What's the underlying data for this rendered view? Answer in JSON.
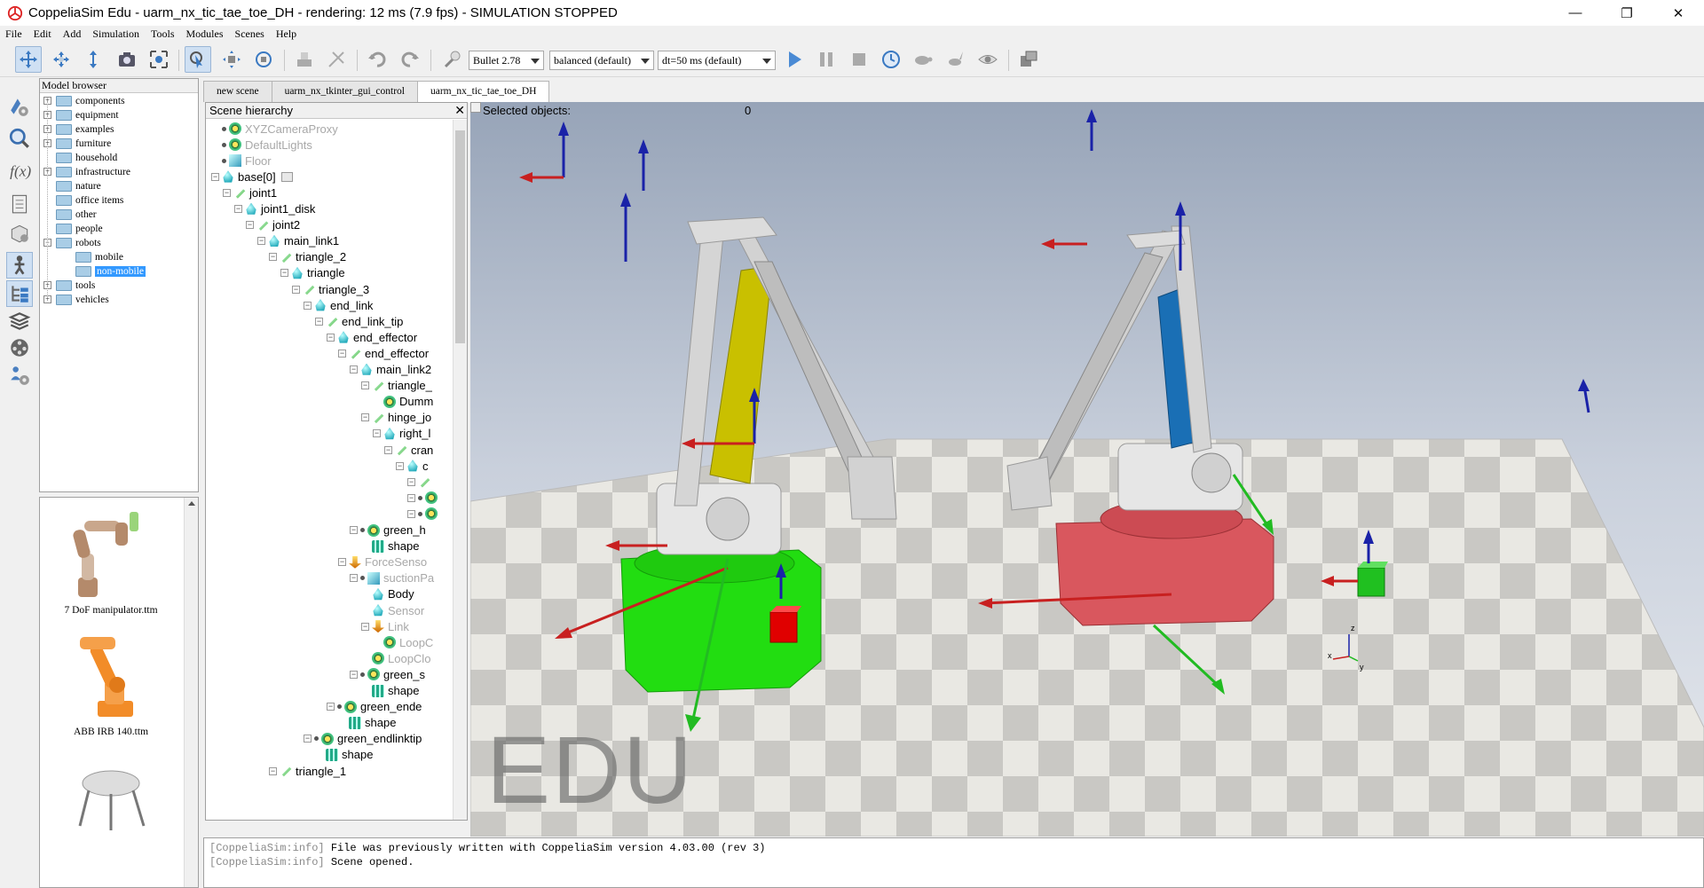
{
  "window": {
    "title": "CoppeliaSim Edu - uarm_nx_tic_tae_toe_DH - rendering: 12 ms (7.9 fps) - SIMULATION STOPPED",
    "minimize": "—",
    "maximize": "❐",
    "close": "✕"
  },
  "menu": [
    "File",
    "Edit",
    "Add",
    "Simulation",
    "Tools",
    "Modules",
    "Scenes",
    "Help"
  ],
  "toolbar": {
    "physics_engine": "Bullet 2.78",
    "accuracy": "balanced (default)",
    "timestep": "dt=50 ms (default)"
  },
  "model_browser": {
    "title": "Model browser",
    "items": [
      {
        "label": "components",
        "expandable": true,
        "level": 0
      },
      {
        "label": "equipment",
        "expandable": true,
        "level": 0
      },
      {
        "label": "examples",
        "expandable": true,
        "level": 0
      },
      {
        "label": "furniture",
        "expandable": true,
        "level": 0
      },
      {
        "label": "household",
        "expandable": false,
        "level": 0
      },
      {
        "label": "infrastructure",
        "expandable": true,
        "level": 0
      },
      {
        "label": "nature",
        "expandable": false,
        "level": 0
      },
      {
        "label": "office items",
        "expandable": false,
        "level": 0
      },
      {
        "label": "other",
        "expandable": false,
        "level": 0
      },
      {
        "label": "people",
        "expandable": false,
        "level": 0
      },
      {
        "label": "robots",
        "expandable": true,
        "expanded": true,
        "level": 0
      },
      {
        "label": "mobile",
        "expandable": false,
        "level": 1
      },
      {
        "label": "non-mobile",
        "expandable": false,
        "level": 1,
        "selected": true
      },
      {
        "label": "tools",
        "expandable": true,
        "level": 0
      },
      {
        "label": "vehicles",
        "expandable": true,
        "level": 0
      }
    ],
    "thumbnails": [
      {
        "caption": "7 DoF manipulator.ttm"
      },
      {
        "caption": "ABB IRB 140.ttm"
      },
      {
        "caption": ""
      }
    ]
  },
  "scene_tabs": [
    {
      "label": "new scene",
      "active": false
    },
    {
      "label": "uarm_nx_tkinter_gui_control",
      "active": false
    },
    {
      "label": "uarm_nx_tic_tae_toe_DH",
      "active": true
    }
  ],
  "hierarchy": {
    "title": "Scene hierarchy",
    "close": "✕",
    "items": [
      {
        "label": "XYZCameraProxy",
        "icon": "camera",
        "depth": 0,
        "dim": true,
        "marker": "dot"
      },
      {
        "label": "DefaultLights",
        "icon": "light",
        "depth": 0,
        "dim": true,
        "marker": "dot"
      },
      {
        "label": "Floor",
        "icon": "cube",
        "depth": 0,
        "dim": true,
        "marker": "dot"
      },
      {
        "label": "base[0]",
        "icon": "shape",
        "depth": 0,
        "marker": "minus",
        "badge": true
      },
      {
        "label": "joint1",
        "icon": "joint",
        "depth": 1,
        "marker": "minus"
      },
      {
        "label": "joint1_disk",
        "icon": "shape",
        "depth": 2,
        "marker": "minus"
      },
      {
        "label": "joint2",
        "icon": "joint",
        "depth": 3,
        "marker": "minus"
      },
      {
        "label": "main_link1",
        "icon": "shape",
        "depth": 4,
        "marker": "minus"
      },
      {
        "label": "triangle_2",
        "icon": "joint",
        "depth": 5,
        "marker": "minus"
      },
      {
        "label": "triangle",
        "icon": "shape",
        "depth": 6,
        "marker": "minus"
      },
      {
        "label": "triangle_3",
        "icon": "joint",
        "depth": 7,
        "marker": "minus"
      },
      {
        "label": "end_link",
        "icon": "shape",
        "depth": 8,
        "marker": "minus"
      },
      {
        "label": "end_link_tip",
        "icon": "joint",
        "depth": 9,
        "marker": "minus"
      },
      {
        "label": "end_effector",
        "icon": "shape",
        "depth": 10,
        "marker": "minus"
      },
      {
        "label": "end_effector",
        "icon": "joint",
        "depth": 11,
        "marker": "minus"
      },
      {
        "label": "main_link2",
        "icon": "shape",
        "depth": 12,
        "marker": "minus"
      },
      {
        "label": "triangle_",
        "icon": "joint",
        "depth": 13,
        "marker": "minus"
      },
      {
        "label": "Dumm",
        "icon": "dummy",
        "depth": 14,
        "marker": "none"
      },
      {
        "label": "hinge_jo",
        "icon": "joint",
        "depth": 13,
        "marker": "minus"
      },
      {
        "label": "right_l",
        "icon": "shape",
        "depth": 14,
        "marker": "minus"
      },
      {
        "label": "cran",
        "icon": "joint",
        "depth": 15,
        "marker": "minus"
      },
      {
        "label": "c",
        "icon": "shape",
        "depth": 16,
        "marker": "minus"
      },
      {
        "label": "",
        "icon": "joint",
        "depth": 17,
        "marker": "minus"
      },
      {
        "label": "",
        "icon": "dummy",
        "depth": 17,
        "marker": "dotminus"
      },
      {
        "label": "",
        "icon": "dummy",
        "depth": 17,
        "marker": "dotminus"
      },
      {
        "label": "green_h",
        "icon": "dummy",
        "depth": 12,
        "marker": "dotminus"
      },
      {
        "label": "shape",
        "icon": "mesh",
        "depth": 13,
        "marker": "none"
      },
      {
        "label": "ForceSenso",
        "icon": "force",
        "depth": 11,
        "dim": true,
        "marker": "minus"
      },
      {
        "label": "suctionPa",
        "icon": "cube",
        "depth": 12,
        "dim": true,
        "marker": "dotminus"
      },
      {
        "label": "Body",
        "icon": "shape",
        "depth": 13,
        "marker": "none"
      },
      {
        "label": "Sensor",
        "icon": "shape",
        "depth": 13,
        "dim": true,
        "marker": "none"
      },
      {
        "label": "Link",
        "icon": "force",
        "depth": 13,
        "dim": true,
        "marker": "minus"
      },
      {
        "label": "LoopC",
        "icon": "dummy",
        "depth": 14,
        "dim": true,
        "marker": "none"
      },
      {
        "label": "LoopClo",
        "icon": "dummy",
        "depth": 13,
        "dim": true,
        "marker": "none"
      },
      {
        "label": "green_s",
        "icon": "dummy",
        "depth": 12,
        "marker": "dotminus"
      },
      {
        "label": "shape",
        "icon": "mesh",
        "depth": 13,
        "marker": "none"
      },
      {
        "label": "green_ende",
        "icon": "dummy",
        "depth": 10,
        "marker": "dotminus"
      },
      {
        "label": "shape",
        "icon": "mesh",
        "depth": 11,
        "marker": "none"
      },
      {
        "label": "green_endlinktip",
        "icon": "dummy",
        "depth": 8,
        "marker": "dotminus"
      },
      {
        "label": "shape",
        "icon": "mesh",
        "depth": 9,
        "marker": "none"
      },
      {
        "label": "triangle_1",
        "icon": "joint",
        "depth": 5,
        "marker": "minus"
      }
    ]
  },
  "viewport": {
    "selected_label": "Selected objects:",
    "selected_count": "0",
    "watermark": "EDU",
    "axis_labels": {
      "x": "x",
      "y": "y",
      "z": "z"
    }
  },
  "console": {
    "lines": [
      {
        "tag": "[CoppeliaSim:info]",
        "text": " File was previously written with CoppeliaSim version 4.03.00 (rev 3)"
      },
      {
        "tag": "[CoppeliaSim:info]",
        "text": " Scene opened."
      }
    ]
  },
  "colors": {
    "selection": "#3399ff",
    "left_robot_base": "#22dd11",
    "right_robot_base": "#d9575e",
    "left_link": "#c9c000",
    "right_link": "#1a6fb5",
    "red_cube": "#e00000",
    "green_cube": "#20c020",
    "sky_top": "#9ca9bc",
    "sky_bottom": "#dde2ea"
  }
}
